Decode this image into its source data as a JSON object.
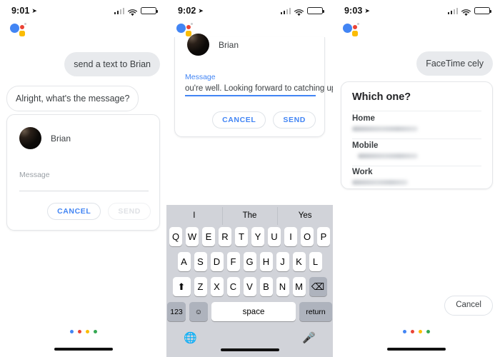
{
  "screens": [
    {
      "id": "screen-1",
      "status": {
        "time": "9:01",
        "location_icon": "location-arrow-icon",
        "signal_icon": "cellular-signal-icon",
        "wifi_icon": "wifi-icon",
        "battery_icon": "battery-charging-icon"
      },
      "assistant_logo": "google-assistant-logo",
      "query": "send a text to Brian",
      "response": "Alright, what's the message?",
      "card": {
        "contact_name": "Brian",
        "avatar": "contact-avatar",
        "message_label": "Message",
        "message_value": "",
        "cancel_label": "CANCEL",
        "send_label": "SEND",
        "send_disabled": true
      },
      "footer_dots": [
        "#4285f4",
        "#ea4335",
        "#fbbc04",
        "#34a853"
      ]
    },
    {
      "id": "screen-2",
      "status": {
        "time": "9:02",
        "location_icon": "location-arrow-icon",
        "signal_icon": "cellular-signal-icon",
        "wifi_icon": "wifi-icon",
        "battery_icon": "battery-charging-icon"
      },
      "assistant_logo": "google-assistant-logo",
      "card": {
        "contact_name": "Brian",
        "avatar": "contact-avatar",
        "message_label": "Message",
        "message_value": "ou're well. Looking forward to catching up.",
        "cancel_label": "CANCEL",
        "send_label": "SEND",
        "send_disabled": false
      },
      "keyboard": {
        "suggestions": [
          "I",
          "The",
          "Yes"
        ],
        "row1": [
          "Q",
          "W",
          "E",
          "R",
          "T",
          "Y",
          "U",
          "I",
          "O",
          "P"
        ],
        "row2": [
          "A",
          "S",
          "D",
          "F",
          "G",
          "H",
          "J",
          "K",
          "L"
        ],
        "row3": [
          "Z",
          "X",
          "C",
          "V",
          "B",
          "N",
          "M"
        ],
        "shift_icon": "shift-up-arrow-icon",
        "delete_icon": "backspace-delete-icon",
        "numbers_label": "123",
        "emoji_icon": "emoji-smiley-icon",
        "space_label": "space",
        "return_label": "return",
        "globe_icon": "globe-language-icon",
        "mic_icon": "microphone-icon"
      }
    },
    {
      "id": "screen-3",
      "status": {
        "time": "9:03",
        "location_icon": "location-arrow-icon",
        "signal_icon": "cellular-signal-icon",
        "wifi_icon": "wifi-icon",
        "battery_icon": "battery-charging-icon"
      },
      "assistant_logo": "google-assistant-logo",
      "query": "FaceTime cely",
      "card": {
        "title": "Which one?",
        "options": [
          {
            "label": "Home",
            "number": "redacted-phone-number"
          },
          {
            "label": "Mobile",
            "number": "redacted-phone-number"
          },
          {
            "label": "Work",
            "number": "redacted-phone-number"
          }
        ]
      },
      "cancel_label": "Cancel",
      "footer_dots": [
        "#4285f4",
        "#ea4335",
        "#fbbc04",
        "#34a853"
      ]
    }
  ],
  "colors": {
    "google_blue": "#4285f4",
    "google_red": "#ea4335",
    "google_yellow": "#fbbc04",
    "google_green": "#34a853",
    "bubble_grey": "#e8eaed",
    "keyboard_bg": "#d1d3d9",
    "key_grey": "#aeb3bd",
    "battery_green": "#2fc24f"
  }
}
